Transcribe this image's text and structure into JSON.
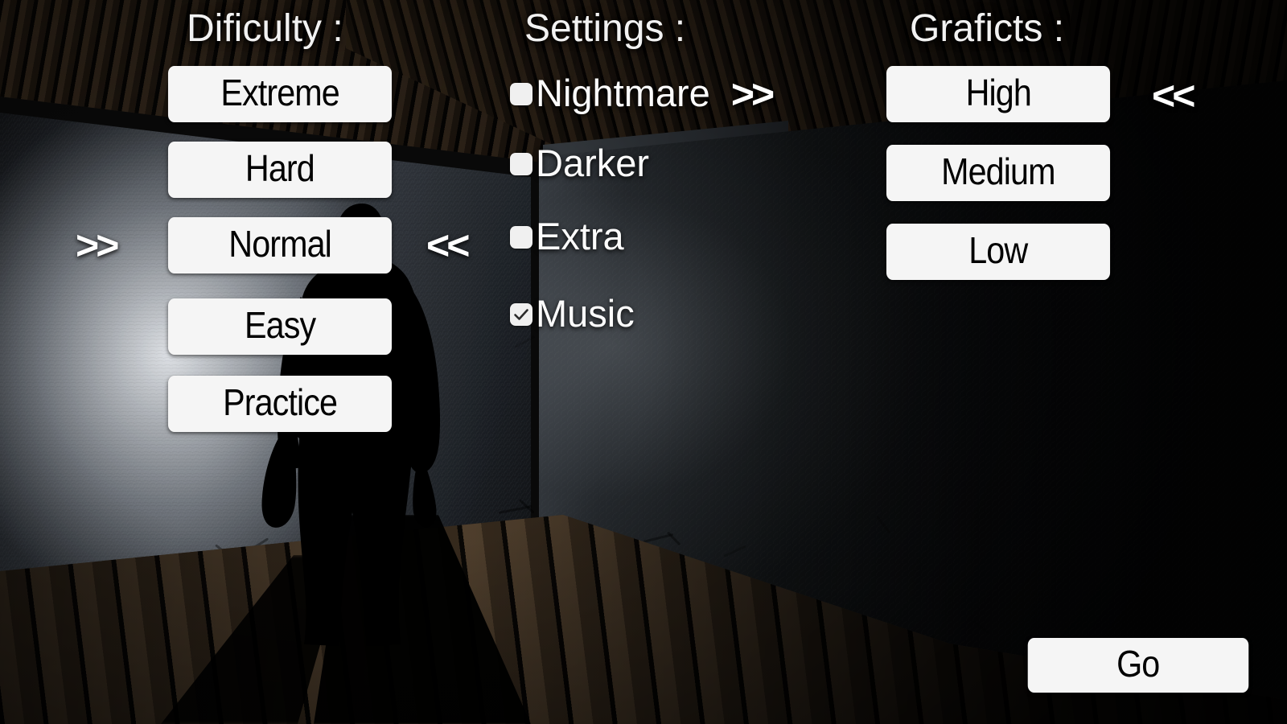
{
  "screen": {
    "title": "game-options-menu"
  },
  "difficulty": {
    "heading": "Dificulty :",
    "options": [
      {
        "label": "Extreme"
      },
      {
        "label": "Hard"
      },
      {
        "label": "Normal"
      },
      {
        "label": "Easy"
      },
      {
        "label": "Practice"
      }
    ],
    "selected": "Normal",
    "marker_left": ">>",
    "marker_right": "<<"
  },
  "settings": {
    "heading": "Settings :",
    "items": [
      {
        "label": "Nightmare",
        "checked": false,
        "marker": ">>"
      },
      {
        "label": "Darker",
        "checked": false,
        "marker": ""
      },
      {
        "label": "Extra",
        "checked": false,
        "marker": ""
      },
      {
        "label": "Music",
        "checked": true,
        "marker": ""
      }
    ]
  },
  "graphics": {
    "heading": "Graficts :",
    "options": [
      {
        "label": "High"
      },
      {
        "label": "Medium"
      },
      {
        "label": "Low"
      }
    ],
    "selected": "High",
    "marker_right": "<<"
  },
  "actions": {
    "go_label": "Go"
  },
  "colors": {
    "button_face": "#f5f5f5",
    "button_text": "#000000",
    "heading_text": "#f2f2f2",
    "arrow": "#ffffff",
    "checkbox_face": "#f0f0f0",
    "checkmark": "#2b2b2b"
  }
}
